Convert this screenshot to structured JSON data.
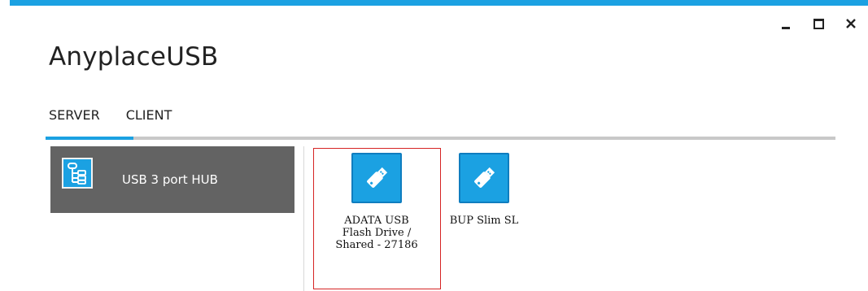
{
  "window": {
    "title": "AnyplaceUSB",
    "controls": {
      "minimize": "minimize-icon",
      "maximize": "maximize-icon",
      "close": "close-icon"
    }
  },
  "tabs": [
    {
      "label": "SERVER",
      "active": true
    },
    {
      "label": "CLIENT",
      "active": false
    }
  ],
  "hubs": [
    {
      "label": "USB 3 port HUB",
      "icon": "hub-tree-icon"
    }
  ],
  "devices": [
    {
      "label": "ADATA USB\nFlash Drive /\nShared - 27186",
      "icon": "usb-drive-icon",
      "selected": true
    },
    {
      "label": "BUP Slim SL",
      "icon": "usb-drive-icon",
      "selected": false
    }
  ],
  "colors": {
    "accent": "#1ba1e2",
    "hub_bg": "#636363",
    "selection": "#d62424"
  }
}
